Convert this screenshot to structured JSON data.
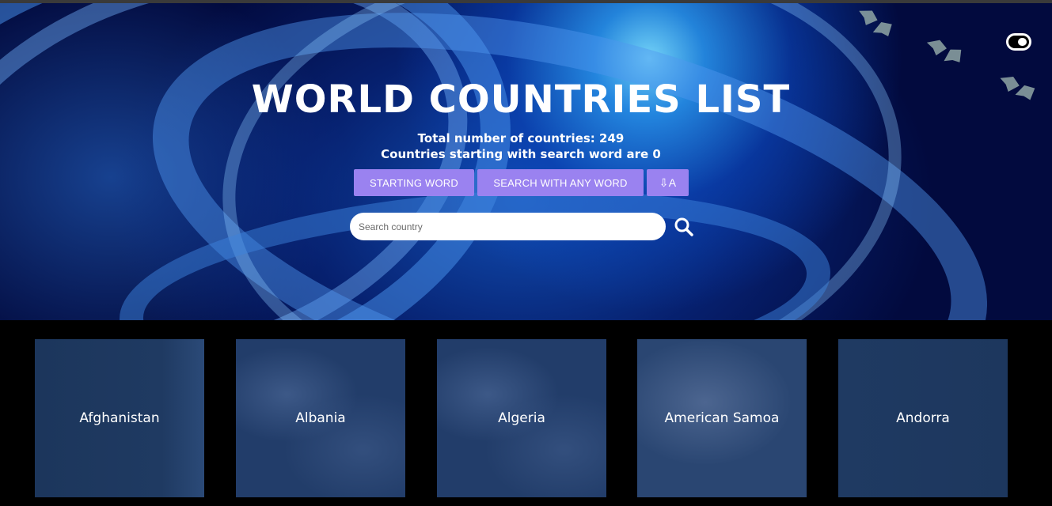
{
  "header": {
    "title": "WORLD COUNTRIES LIST",
    "total_text": "Total number of countries: 249",
    "search_result_text": "Countries starting with search word are 0",
    "theme_toggle_icon": "toggle-icon"
  },
  "buttons": {
    "starting_word": "STARTING WORD",
    "any_word": "SEARCH WITH ANY WORD",
    "sort_label": "⇩A",
    "sort_icon": "sort-alpha-down-icon"
  },
  "search": {
    "placeholder": "Search country",
    "value": "",
    "icon": "search-icon"
  },
  "countries": [
    "Afghanistan",
    "Albania",
    "Algeria",
    "American Samoa",
    "Andorra"
  ],
  "colors": {
    "accent": "#9a82f0",
    "background": "#000000",
    "card": "#223d6a"
  }
}
